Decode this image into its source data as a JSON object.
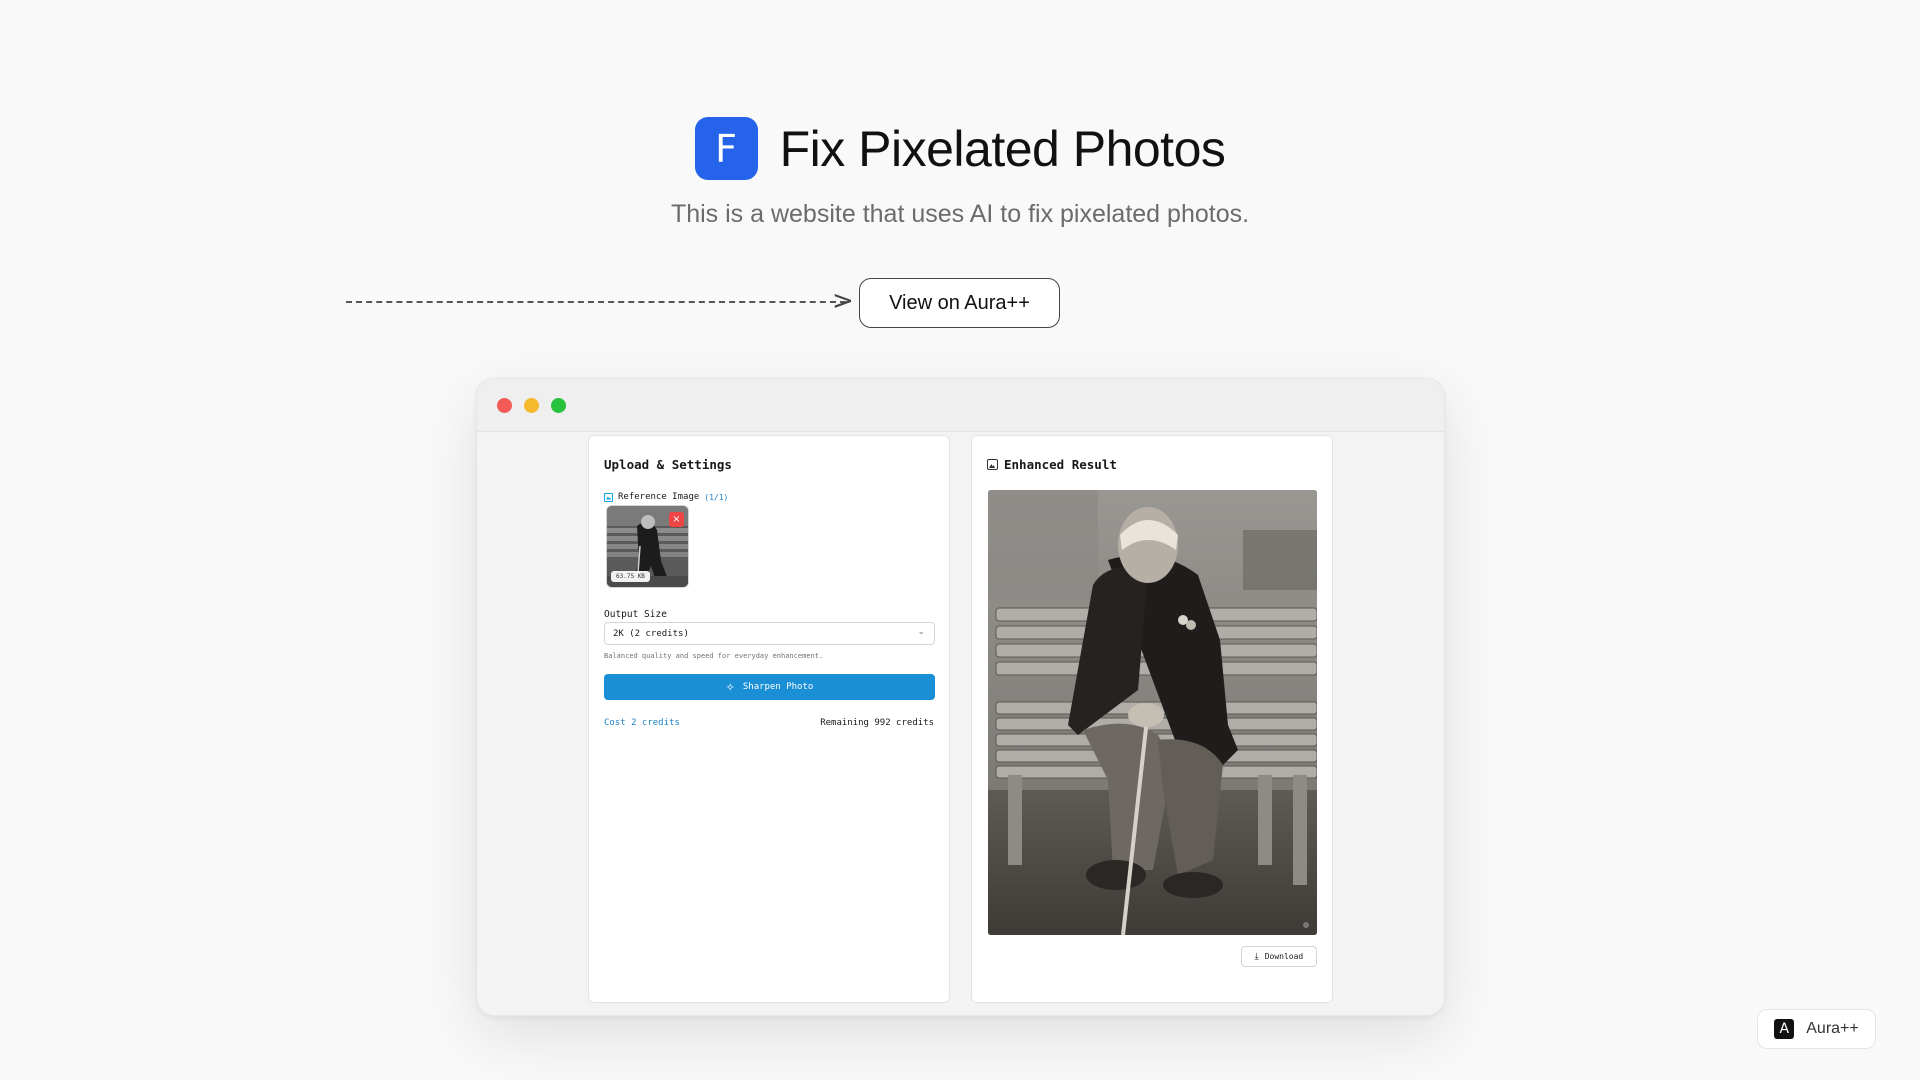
{
  "hero": {
    "logo_letter": "F",
    "title": "Fix Pixelated Photos",
    "subtitle": "This is a website that uses AI to fix pixelated photos.",
    "cta_label": "View on Aura++"
  },
  "app_window": {
    "upload_panel": {
      "title": "Upload & Settings",
      "reference_label": "Reference Image",
      "reference_count": "(1/1)",
      "thumbnail_size": "63.75 KB",
      "remove_icon": "×",
      "output_size_label": "Output Size",
      "output_size_value": "2K (2 credits)",
      "output_size_helper": "Balanced quality and speed for everyday enhancement.",
      "sharpen_label": "Sharpen Photo",
      "cost_text": "Cost 2 credits",
      "remaining_text": "Remaining 992 credits"
    },
    "result_panel": {
      "title": "Enhanced Result",
      "download_label": "Download"
    }
  },
  "badge": {
    "logo_letter": "A",
    "label": "Aura++"
  },
  "colors": {
    "accent_blue": "#2563eb",
    "button_blue": "#1b8fd6",
    "link_blue": "#1f82c8",
    "close_red": "#f25b56",
    "minimize_yellow": "#f6b82d",
    "maximize_green": "#29c23d"
  }
}
